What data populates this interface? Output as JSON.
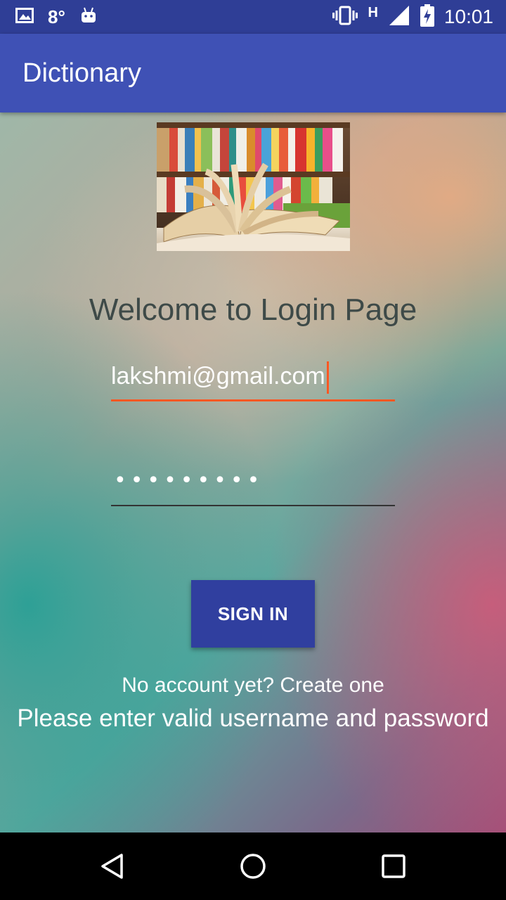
{
  "status_bar": {
    "temperature": "8°",
    "network_type": "H",
    "time": "10:01",
    "icons": [
      "image-notification-icon",
      "android-icon",
      "vibrate-icon",
      "network-h-icon",
      "signal-icon",
      "battery-charging-icon"
    ]
  },
  "app_bar": {
    "title": "Dictionary"
  },
  "main": {
    "header_image": "open-book-on-shelf-image",
    "welcome_title": "Welcome to Login Page",
    "email_value": "lakshmi@gmail.com",
    "password_mask": "•••••••••",
    "sign_in_label": "SIGN IN",
    "create_account_text": "No account yet? Create one",
    "error_message": "Please enter valid username and password"
  },
  "nav_bar": {
    "icons": [
      "back-icon",
      "home-icon",
      "recents-icon"
    ]
  },
  "colors": {
    "status_bar": "#2f3e96",
    "app_bar": "#3f51b5",
    "button": "#303f9f",
    "accent": "#ff5722"
  }
}
